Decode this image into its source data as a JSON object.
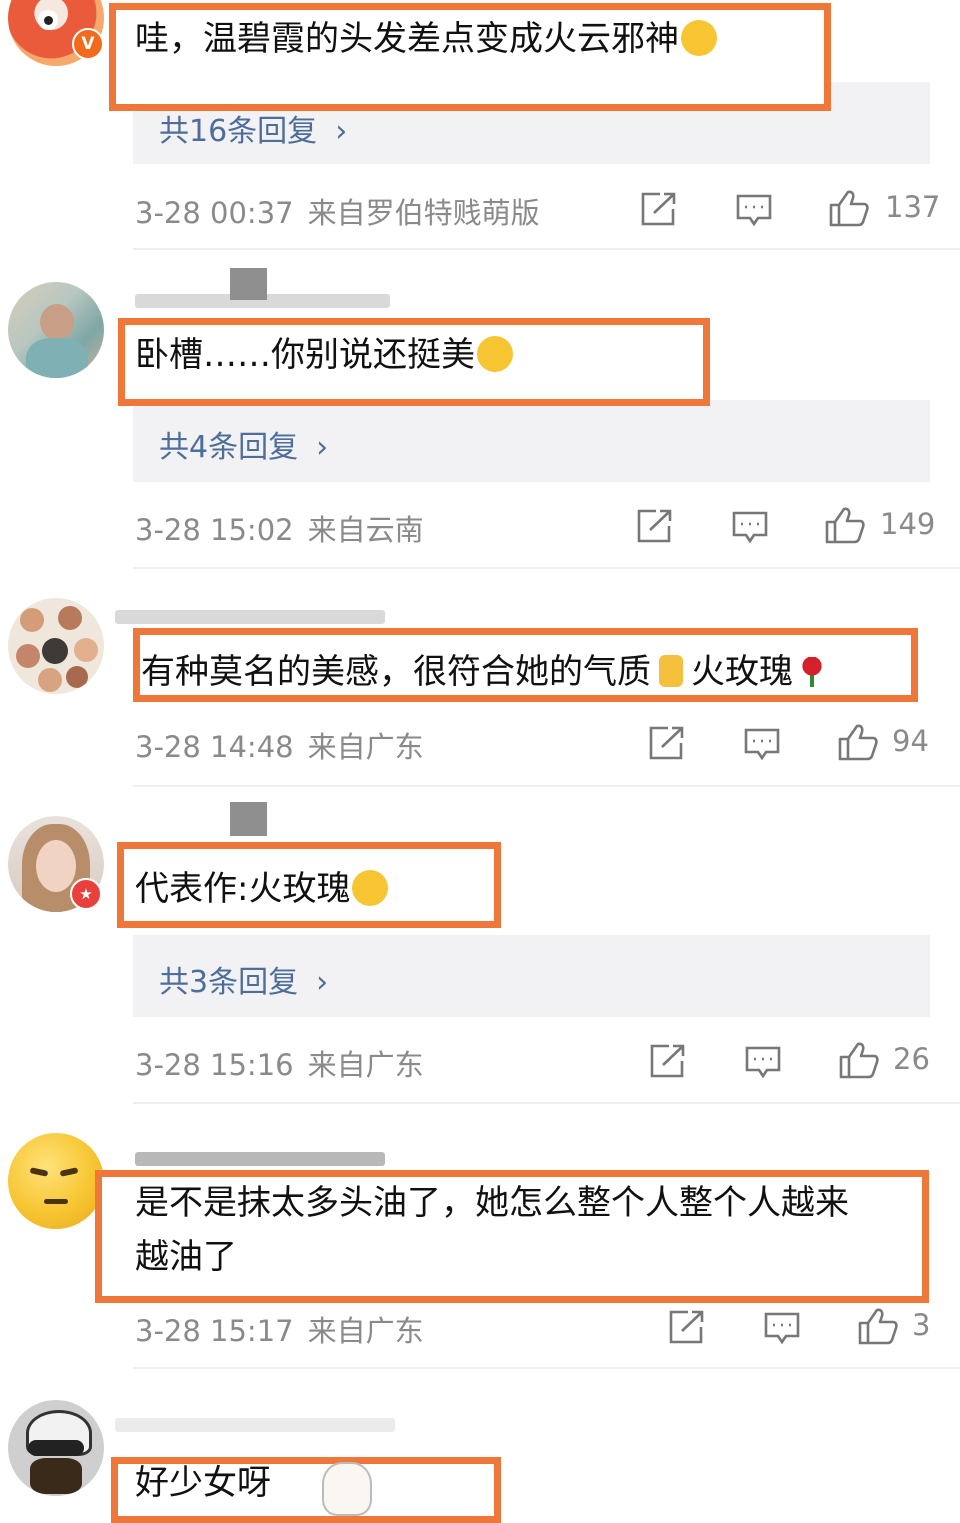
{
  "comments": [
    {
      "text": "哇，温碧霞的头发差点变成火云邪神",
      "replies": "共16条回复",
      "time": "3-28 00:37",
      "source": "来自罗伯特贱萌版",
      "likes": "137",
      "badge": "V"
    },
    {
      "text": "卧槽……你别说还挺美",
      "replies": "共4条回复",
      "time": "3-28 15:02",
      "source": "来自云南",
      "likes": "149"
    },
    {
      "text": "有种莫名的美感，很符合她的气质",
      "text_tail": "火玫瑰",
      "time": "3-28 14:48",
      "source": "来自广东",
      "likes": "94"
    },
    {
      "text": "代表作:火玫瑰",
      "replies": "共3条回复",
      "time": "3-28 15:16",
      "source": "来自广东",
      "likes": "26",
      "badge": "★"
    },
    {
      "text_line1": "是不是抹太多头油了，她怎么整个人整个人越来",
      "text_line2": "越油了",
      "time": "3-28 15:17",
      "source": "来自广东",
      "likes": "3"
    },
    {
      "text": "好少女呀"
    }
  ],
  "icons": {
    "share": "share-icon",
    "comment": "comment-icon",
    "like": "thumbs-up-icon"
  },
  "colors": {
    "highlight": "#f0773a",
    "reply_link": "#4d6d9a",
    "meta": "#8a8a8a"
  }
}
